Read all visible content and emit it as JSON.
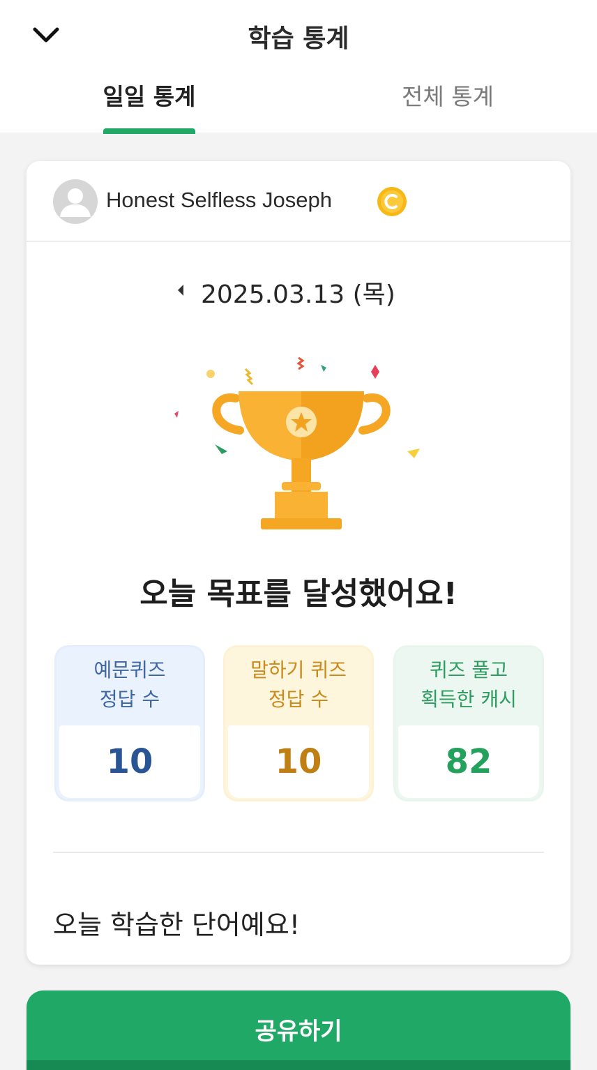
{
  "header": {
    "title": "학습 통계",
    "tabs": [
      {
        "label": "일일 통계",
        "active": true
      },
      {
        "label": "전체 통계",
        "active": false
      }
    ]
  },
  "profile": {
    "name": "Honest Selfless Joseph",
    "badge_icon": "coin-icon"
  },
  "date": {
    "text": "2025.03.13 (목)"
  },
  "achievement": {
    "message": "오늘 목표를 달성했어요!"
  },
  "stats": [
    {
      "line1": "예문퀴즈",
      "line2": "정답 수",
      "value": "10",
      "color": "#2a5594"
    },
    {
      "line1": "말하기 퀴즈",
      "line2": "정답 수",
      "value": "10",
      "color": "#c07f13"
    },
    {
      "line1": "퀴즈 풀고",
      "line2": "획득한 캐시",
      "value": "82",
      "color": "#23a15d"
    }
  ],
  "words_section": {
    "title": "오늘 학습한 단어예요!"
  },
  "share_button": {
    "label": "공유하기"
  },
  "colors": {
    "accent": "#1fa866",
    "coin": "#f7b816"
  }
}
